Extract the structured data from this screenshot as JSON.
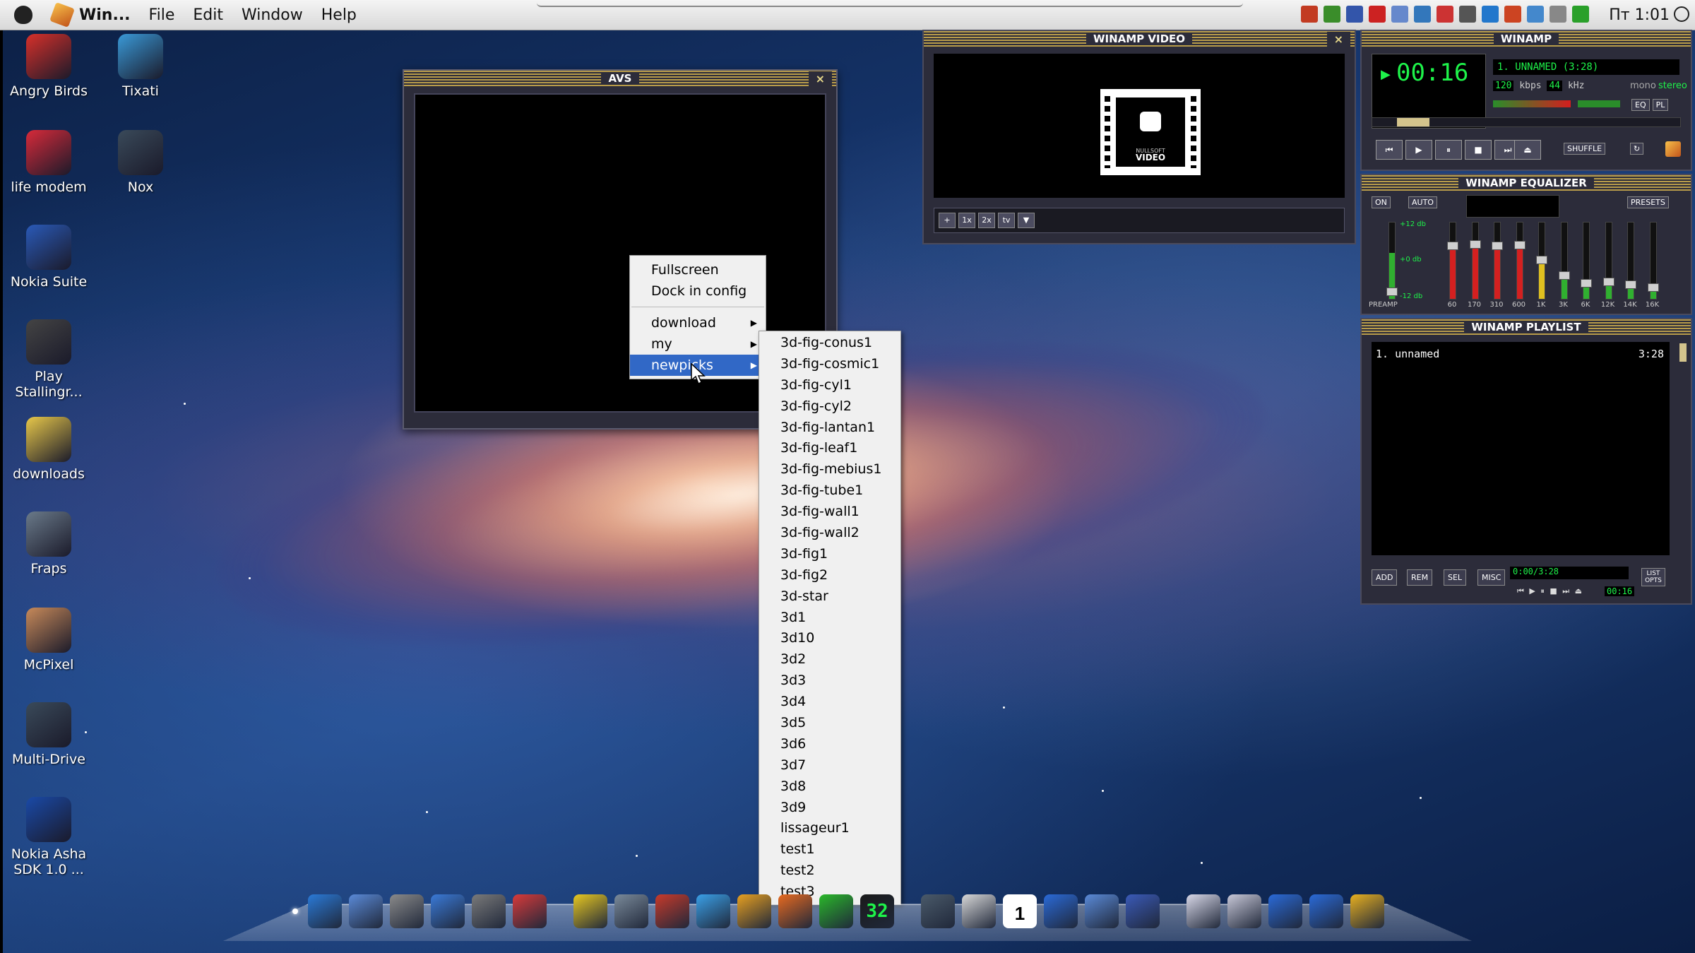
{
  "menubar": {
    "app_name": "Win...",
    "menus": [
      "File",
      "Edit",
      "Window",
      "Help"
    ],
    "clock": "Пт 1:01",
    "tray_colors": [
      "#c23b22",
      "#3a8d2a",
      "#3355aa",
      "#cc2222",
      "#6688cc",
      "#3377bb",
      "#cc3333",
      "#555555",
      "#2277cc",
      "#cc4422",
      "#4488cc",
      "#888888",
      "#2aa02a"
    ]
  },
  "desktop_icons": [
    {
      "label": "Angry Birds",
      "color": "#d8302a"
    },
    {
      "label": "Tixati",
      "color": "#3a9ad8"
    },
    {
      "label": "life modem",
      "color": "#d82a3a"
    },
    {
      "label": "Nox",
      "color": "#3a4a5a"
    },
    {
      "label": "Nokia Suite",
      "color": "#2a5ab8"
    },
    {
      "label": "Play Stallingr...",
      "color": "#444444"
    },
    {
      "label": "downloads",
      "color": "#e8c84a"
    },
    {
      "label": "Fraps",
      "color": "#6a7a8a"
    },
    {
      "label": "McPixel",
      "color": "#c88a5a"
    },
    {
      "label": "Multi-Drive",
      "color": "#3a4a5a"
    },
    {
      "label": "Nokia Asha SDK 1.0 ...",
      "color": "#1a4aa8"
    }
  ],
  "avs": {
    "title": "AVS",
    "close": "×"
  },
  "winamp_video": {
    "title": "WINAMP VIDEO",
    "logo_top": "NULLSOFT",
    "logo_bottom": "VIDEO",
    "buttons": [
      "+",
      "1x",
      "2x",
      "tv",
      "▼"
    ]
  },
  "winamp": {
    "title": "WINAMP",
    "time": "00:16",
    "song": "1. UNNAMED (3:28)",
    "kbps": "120",
    "kbps_label": "kbps",
    "khz": "44",
    "khz_label": "kHz",
    "mono": "mono",
    "stereo": "stereo",
    "eq_btn": "EQ",
    "pl_btn": "PL",
    "shuffle": "SHUFFLE",
    "repeat": "↻",
    "transport": [
      "⏮",
      "▶",
      "⏸",
      "■",
      "⏭"
    ],
    "eject": "⏏",
    "volume": 0.55,
    "seek": 0.08
  },
  "equalizer": {
    "title": "WINAMP EQUALIZER",
    "on": "ON",
    "auto": "AUTO",
    "presets": "PRESETS",
    "db_top": "+12 db",
    "db_mid": "+0 db",
    "db_bot": "-12 db",
    "preamp": "PREAMP",
    "bands": [
      {
        "label": "60",
        "level": 0.72,
        "color": "#d42020"
      },
      {
        "label": "170",
        "level": 0.75,
        "color": "#d42020"
      },
      {
        "label": "310",
        "level": 0.72,
        "color": "#d42020"
      },
      {
        "label": "600",
        "level": 0.73,
        "color": "#d42020"
      },
      {
        "label": "1K",
        "level": 0.52,
        "color": "#e0c020"
      },
      {
        "label": "3K",
        "level": 0.3,
        "color": "#30b030"
      },
      {
        "label": "6K",
        "level": 0.18,
        "color": "#30b030"
      },
      {
        "label": "12K",
        "level": 0.2,
        "color": "#30b030"
      },
      {
        "label": "14K",
        "level": 0.16,
        "color": "#30b030"
      },
      {
        "label": "16K",
        "level": 0.12,
        "color": "#30b030"
      }
    ]
  },
  "playlist": {
    "title": "WINAMP PLAYLIST",
    "item": "1. unnamed",
    "duration": "3:28",
    "buttons": [
      "ADD",
      "REM",
      "SEL",
      "MISC"
    ],
    "list_opts": "LIST OPTS",
    "mini_time": "0:00/3:28",
    "mini_pos": "00:16",
    "mini_controls": "⏮ ▶ ⏸ ■ ⏭ ⏏"
  },
  "context_menu": {
    "items": [
      "Fullscreen",
      "Dock in config"
    ],
    "sub_items": [
      "download",
      "my",
      "newpicks"
    ],
    "arrow": "▶"
  },
  "submenu": {
    "items": [
      "3d-fig-conus1",
      "3d-fig-cosmic1",
      "3d-fig-cyl1",
      "3d-fig-cyl2",
      "3d-fig-lantan1",
      "3d-fig-leaf1",
      "3d-fig-mebius1",
      "3d-fig-tube1",
      "3d-fig-wall1",
      "3d-fig-wall2",
      "3d-fig1",
      "3d-fig2",
      "3d-star",
      "3d1",
      "3d10",
      "3d2",
      "3d3",
      "3d4",
      "3d5",
      "3d6",
      "3d7",
      "3d8",
      "3d9",
      "lissageur1",
      "test1",
      "test2",
      "test3"
    ]
  },
  "dock": {
    "calendar_day": "1",
    "clock_digits": "32",
    "icon_colors": [
      "#2a7ad8",
      "#5a8ad8",
      "#8a8a8a",
      "#3a7ad8",
      "#7a7a7a",
      "#d83a3a",
      "#e8c820",
      "#7a8a9a",
      "#c83a2a",
      "#3aa0e8",
      "#e8a020",
      "#e86a20",
      "#2ab82a",
      "#1a1a1a",
      "#4a5a6a",
      "#d8d8d8",
      "#3a9ad8",
      "#2a6ad8",
      "#5a8ad8",
      "#3a5ab8",
      "#d8d8e8",
      "#c8c8d8",
      "#2a6ad8",
      "#2a6ad8",
      "#e8b020"
    ]
  }
}
